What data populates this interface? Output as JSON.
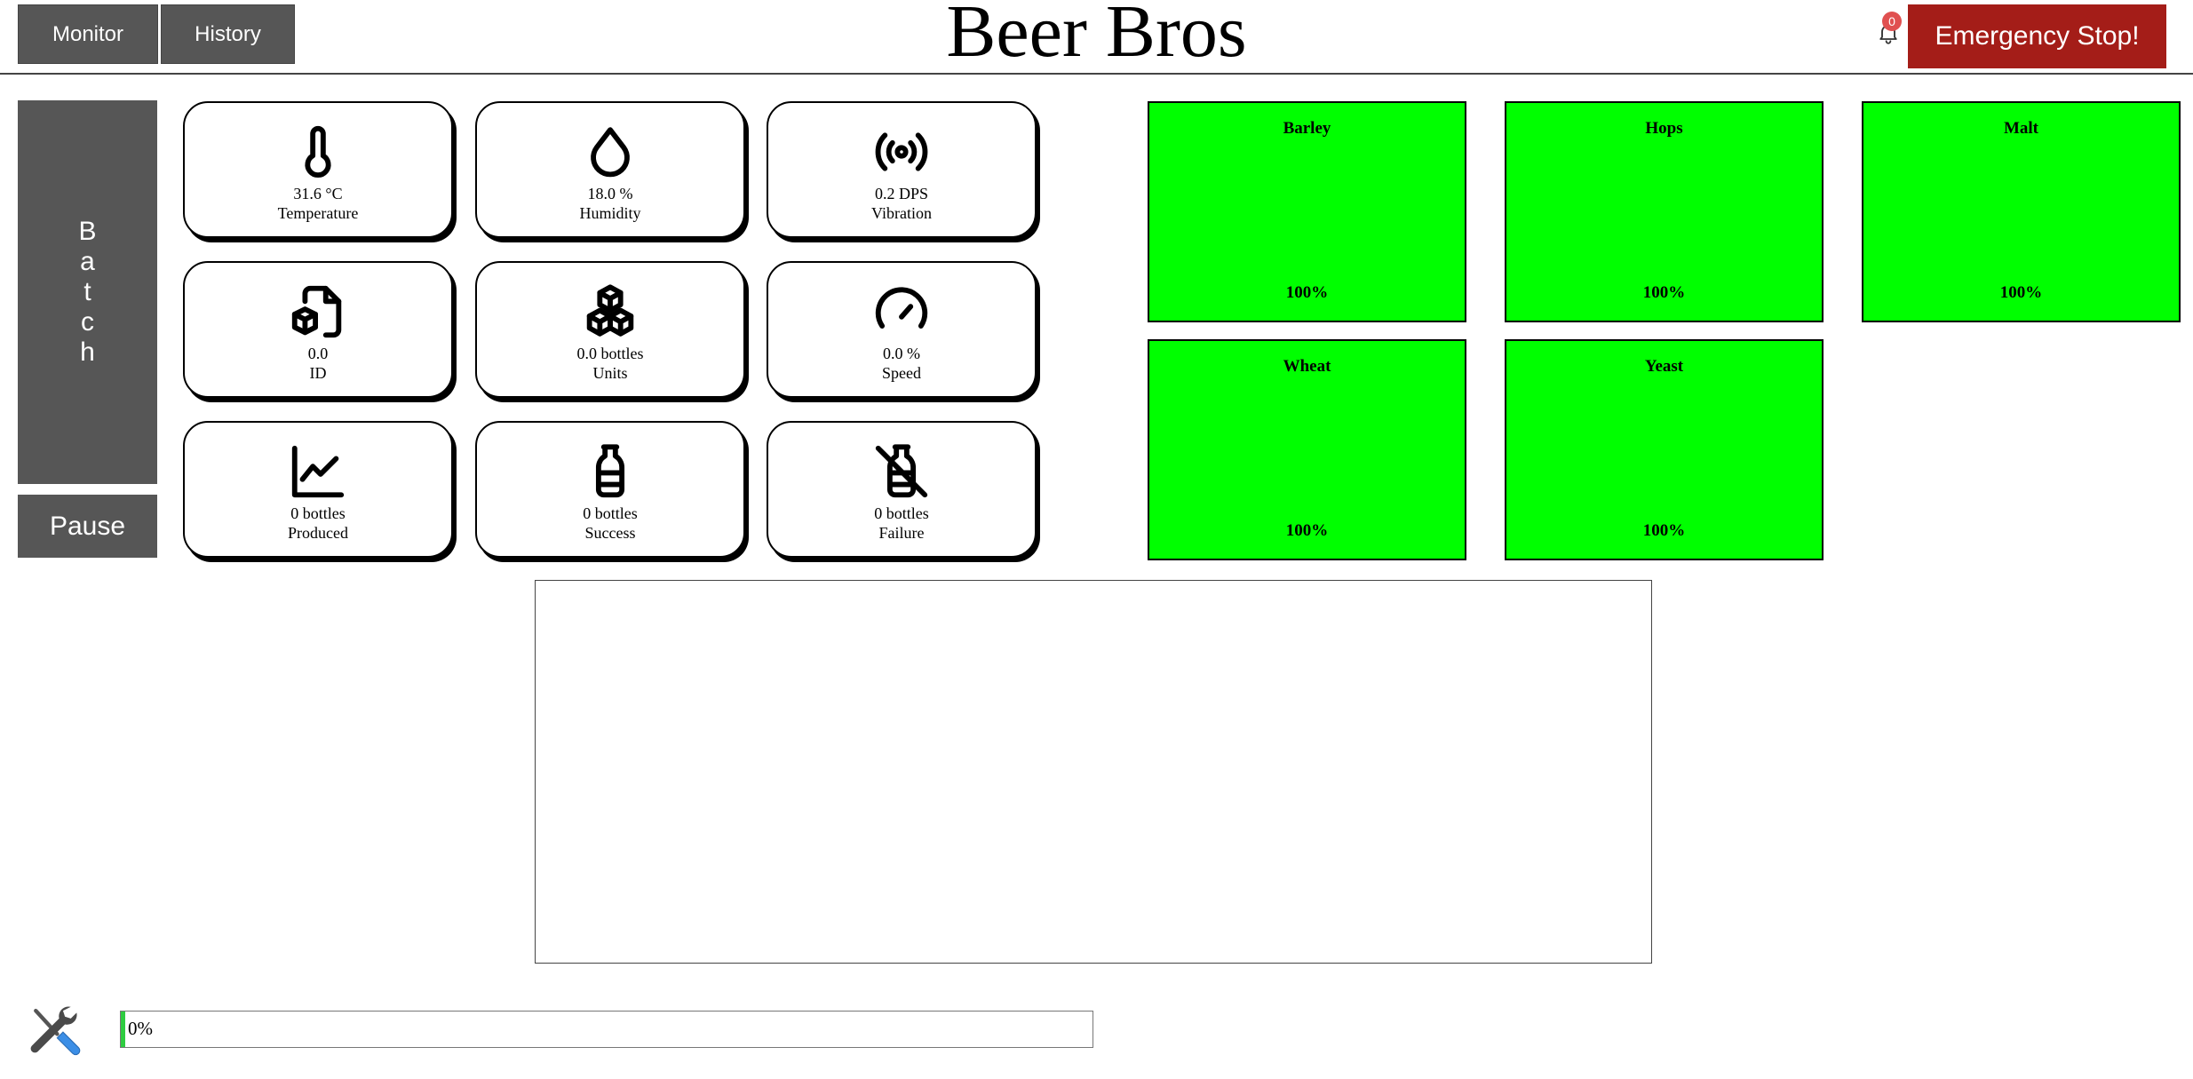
{
  "header": {
    "nav": [
      {
        "label": "Monitor"
      },
      {
        "label": "History"
      }
    ],
    "title": "Beer Bros",
    "notifications": {
      "count": "0"
    },
    "emergency_stop_label": "Emergency Stop!"
  },
  "sidebar": {
    "batch_label": [
      "B",
      "a",
      "t",
      "c",
      "h"
    ],
    "pause_label": "Pause"
  },
  "metrics": [
    {
      "icon": "thermometer-icon",
      "value": "31.6 °C",
      "label": "Temperature"
    },
    {
      "icon": "droplet-icon",
      "value": "18.0 %",
      "label": "Humidity"
    },
    {
      "icon": "vibration-icon",
      "value": "0.2 DPS",
      "label": "Vibration"
    },
    {
      "icon": "file-cube-icon",
      "value": "0.0",
      "label": "ID"
    },
    {
      "icon": "boxes-icon",
      "value": "0.0 bottles",
      "label": "Units"
    },
    {
      "icon": "gauge-icon",
      "value": "0.0 %",
      "label": "Speed"
    },
    {
      "icon": "chart-line-icon",
      "value": "0 bottles",
      "label": "Produced"
    },
    {
      "icon": "bottle-icon",
      "value": "0 bottles",
      "label": "Success"
    },
    {
      "icon": "bottle-off-icon",
      "value": "0 bottles",
      "label": "Failure"
    }
  ],
  "ingredients": [
    {
      "name": "Barley",
      "level": "100%",
      "color": "#00ff00"
    },
    {
      "name": "Hops",
      "level": "100%",
      "color": "#00ff00"
    },
    {
      "name": "Malt",
      "level": "100%",
      "color": "#00ff00"
    },
    {
      "name": "Wheat",
      "level": "100%",
      "color": "#00ff00"
    },
    {
      "name": "Yeast",
      "level": "100%",
      "color": "#00ff00"
    }
  ],
  "footer": {
    "tools_icon": "tools-icon",
    "progress": {
      "text": "0%",
      "value": 0,
      "color": "#2ecc40"
    }
  },
  "colors": {
    "nav": "#565656",
    "emergency": "#a41d18",
    "badge": "#e05050"
  }
}
